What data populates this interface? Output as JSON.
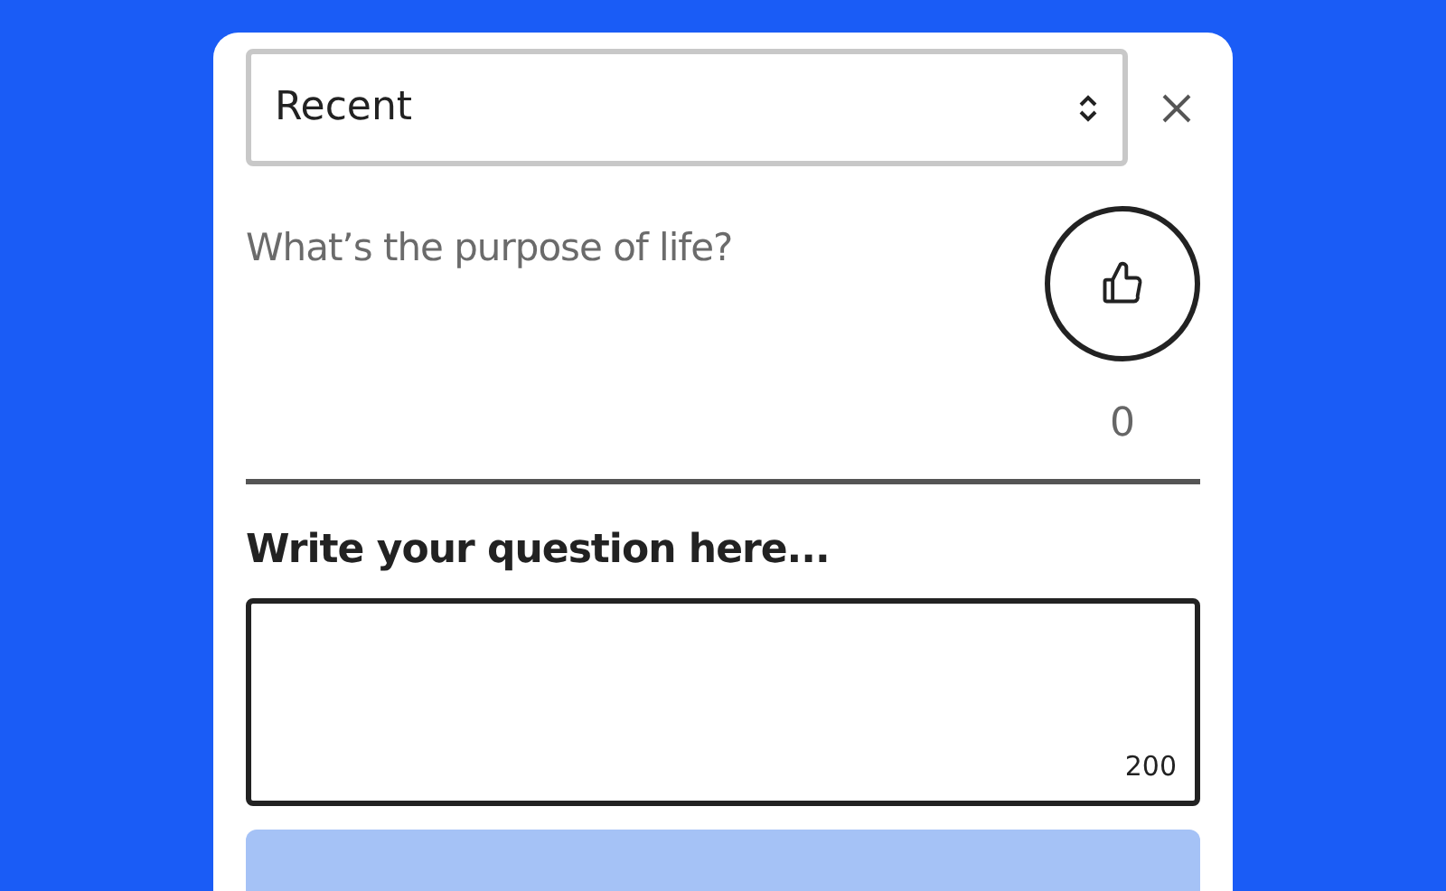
{
  "sort_select": {
    "value": "Recent"
  },
  "questions": [
    {
      "text": "What’s the purpose of life?",
      "likes": "0",
      "liked": false
    }
  ],
  "form": {
    "label": "Write your question here...",
    "char_count": "200",
    "submit_disabled": true
  }
}
